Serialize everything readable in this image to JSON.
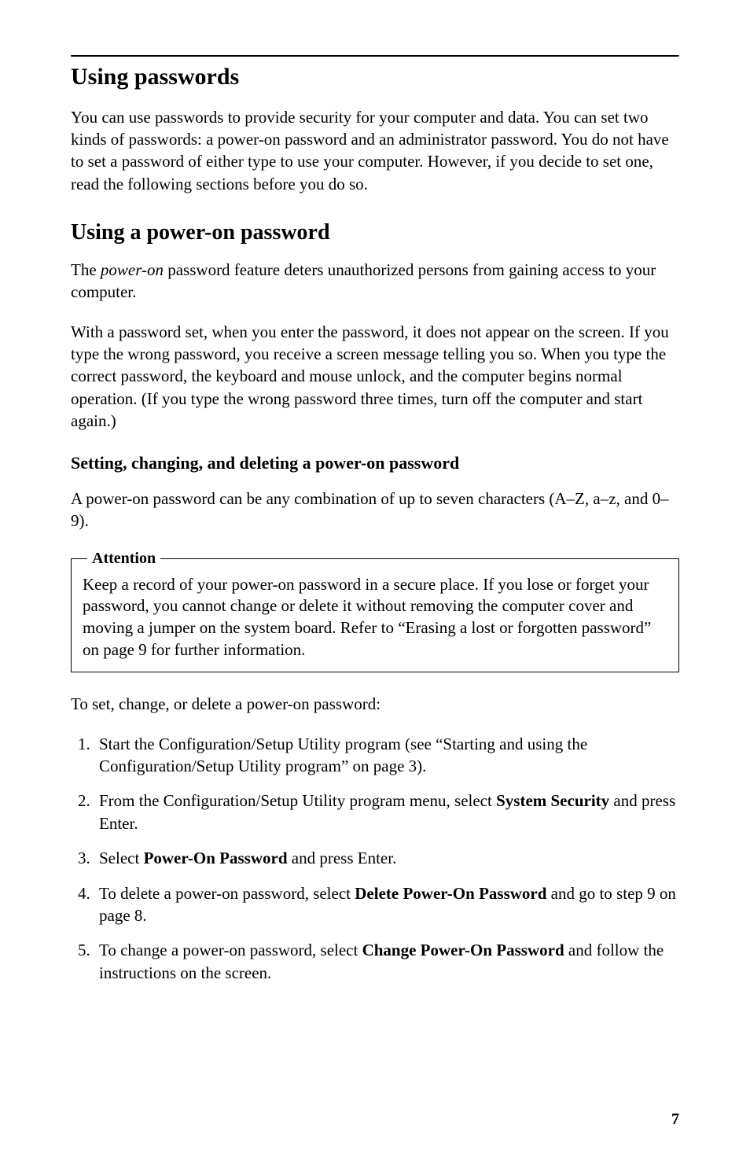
{
  "page_number": "7",
  "h1": "Using passwords",
  "p1": "You can use passwords to provide security for your computer and data. You can set two kinds of passwords:  a power-on password and an administrator password.  You do not have to set a password of either type to use your computer.  However, if you decide to set one, read the following sections before you do so.",
  "h2": "Using a power-on password",
  "p2_pre": "The ",
  "p2_em": "power-on",
  "p2_post": " password feature deters unauthorized persons from gaining access to your computer.",
  "p3": "With a password set, when you enter the password, it does not appear on the screen.  If you type the wrong password, you receive a screen message telling you so.  When you type the correct password, the keyboard and mouse unlock, and the computer begins normal operation.  (If you type the wrong password three times, turn off the computer and start again.)",
  "h3": "Setting, changing, and deleting a power-on password",
  "p4": "A power-on password can be any combination of up to seven characters (A–Z, a–z, and 0–9).",
  "attention": {
    "legend": "Attention",
    "body": "Keep a record of your power-on password in a secure place.  If you lose or forget your password, you cannot change or delete it without removing the computer cover and moving a jumper on the system board.  Refer to “Erasing a lost or forgotten password” on page 9 for further information."
  },
  "p5": "To set, change, or delete a power-on password:",
  "steps": {
    "s1": "Start the Configuration/Setup Utility program (see “Starting and using the Configuration/Setup Utility program” on page 3).",
    "s2_pre": "From the Configuration/Setup Utility program menu, select ",
    "s2_strong": "System Security",
    "s2_post": " and press Enter.",
    "s3_pre": "Select ",
    "s3_strong": "Power-On Password",
    "s3_post": " and press Enter.",
    "s4_pre": "To delete a power-on password, select ",
    "s4_strong": "Delete Power-On Password",
    "s4_post": " and go to step 9 on page 8.",
    "s5_pre": "To change a power-on password, select ",
    "s5_strong": "Change Power-On Password",
    "s5_post": " and follow the instructions on the screen."
  }
}
